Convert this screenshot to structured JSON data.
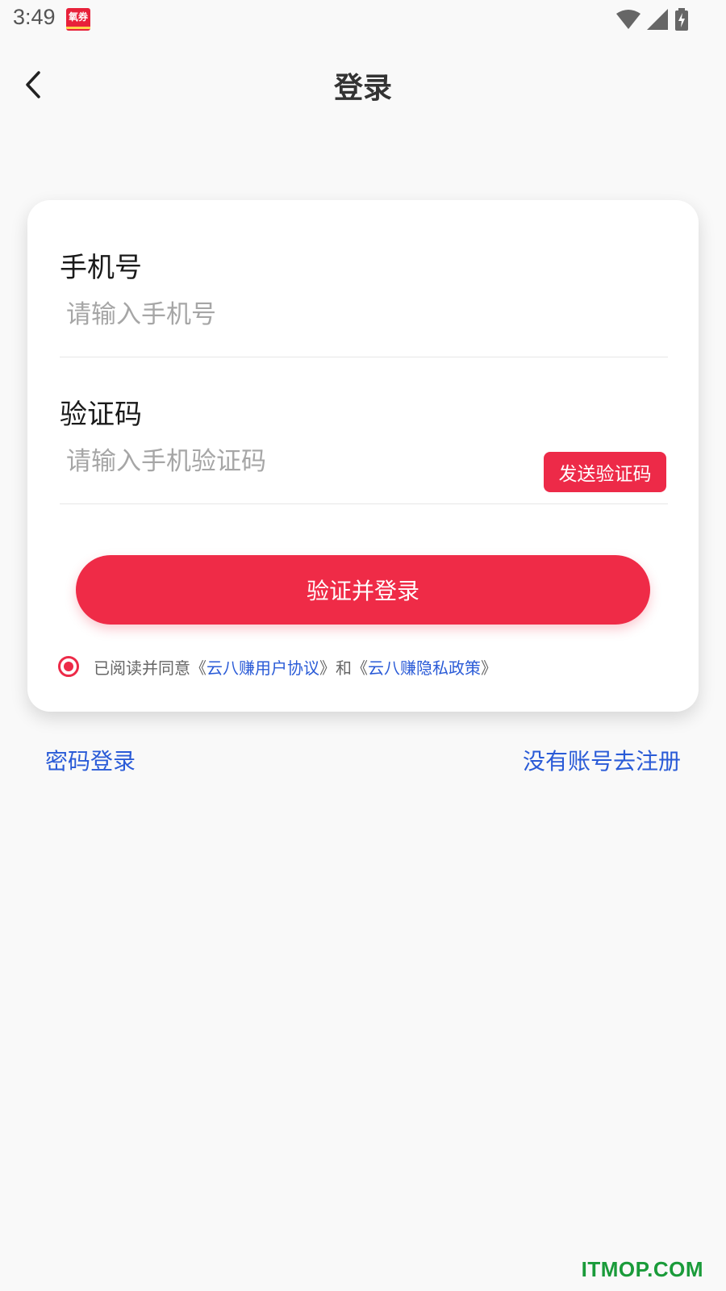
{
  "status_bar": {
    "time": "3:49",
    "app_badge_text": "氧券",
    "icons": [
      "wifi-icon",
      "signal-icon",
      "battery-charging-icon"
    ]
  },
  "header": {
    "title": "登录",
    "back_icon": "chevron-left-icon"
  },
  "form": {
    "phone": {
      "label": "手机号",
      "placeholder": "请输入手机号",
      "value": ""
    },
    "code": {
      "label": "验证码",
      "placeholder": "请输入手机验证码",
      "value": "",
      "send_button": "发送验证码"
    },
    "submit_label": "验证并登录",
    "agreement": {
      "checked": true,
      "prefix": "已阅读并同意《",
      "user_agreement": "云八赚用户协议",
      "middle": "》和《",
      "privacy_policy": "云八赚隐私政策",
      "suffix": "》"
    }
  },
  "footer_links": {
    "password_login": "密码登录",
    "register": "没有账号去注册"
  },
  "watermark": "ITMOP.COM",
  "colors": {
    "accent": "#ef2b47",
    "link": "#2a5bd7",
    "background": "#f9f9f9"
  }
}
